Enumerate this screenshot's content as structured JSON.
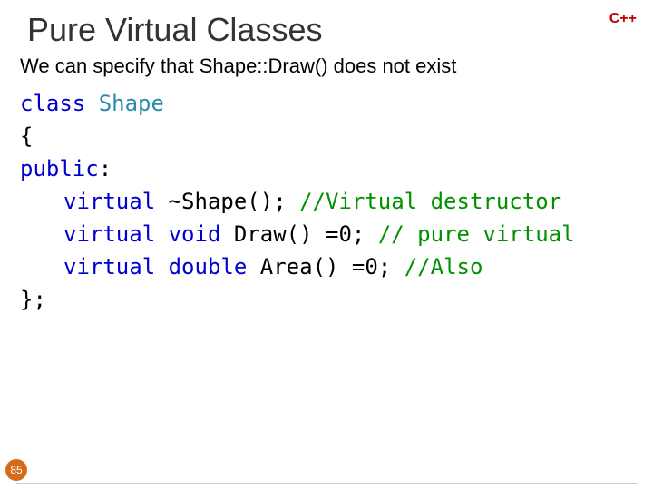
{
  "title": "Pure Virtual Classes",
  "lang_badge": "C++",
  "intro": "We can specify that Shape::Draw() does not exist",
  "code": {
    "l1": {
      "kw": "class",
      "sp": " ",
      "cls": "Shape"
    },
    "l2": "{",
    "l3": {
      "kw": "public",
      "rest": ":"
    },
    "l4": {
      "kw": "virtual",
      "sp": " ",
      "rest": "~Shape(); ",
      "cm": "//Virtual destructor"
    },
    "l5": {
      "kw1": "virtual",
      "sp1": " ",
      "kw2": "void",
      "sp2": " ",
      "rest": "Draw() =0; ",
      "cm": "// pure virtual"
    },
    "l6": {
      "kw1": "virtual",
      "sp1": " ",
      "kw2": "double",
      "sp2": " ",
      "rest": "Area() =0; ",
      "cm": "//Also"
    },
    "l7": "};"
  },
  "page_number": "85"
}
